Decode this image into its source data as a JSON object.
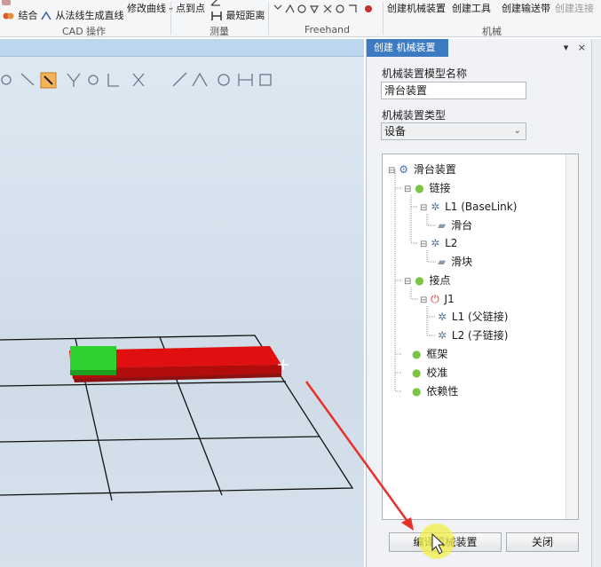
{
  "ribbon": {
    "cad_group": {
      "label": "CAD 操作",
      "items": [
        "结合",
        "从法线生成直线",
        "修改曲线"
      ]
    },
    "measure_group": {
      "label": "测量",
      "items": [
        "点到点",
        "最短距离"
      ]
    },
    "freehand_group": {
      "label": "Freehand"
    },
    "mechanism_group": {
      "label": "机械",
      "items": [
        "创建机械装置",
        "创建工具",
        "创建输送带",
        "创建连接"
      ]
    }
  },
  "panel": {
    "tab_title": "创建 机械装置",
    "pin_symbol": "▾",
    "close_symbol": "×",
    "model_name_label": "机械装置模型名称",
    "model_name_value": "滑台装置",
    "type_label": "机械装置类型",
    "type_value": "设备",
    "tree": {
      "root": "滑台装置",
      "links": "链接",
      "l1": "L1 (BaseLink)",
      "l1_part": "滑台",
      "l2": "L2",
      "l2_part": "滑块",
      "joints": "接点",
      "j1": "J1",
      "j1_parent": "L1 (父链接)",
      "j1_child": "L2 (子链接)",
      "frame": "框架",
      "calibration": "校准",
      "dependency": "依赖性"
    },
    "compile_button": "编译机械装置",
    "close_button": "关闭"
  },
  "colors": {
    "accent": "#3c7ac2",
    "base_part": "#e01010",
    "slider_part": "#2ed22e",
    "annotation_arrow": "#e8302a",
    "cursor_highlight": "#f1ef47"
  }
}
